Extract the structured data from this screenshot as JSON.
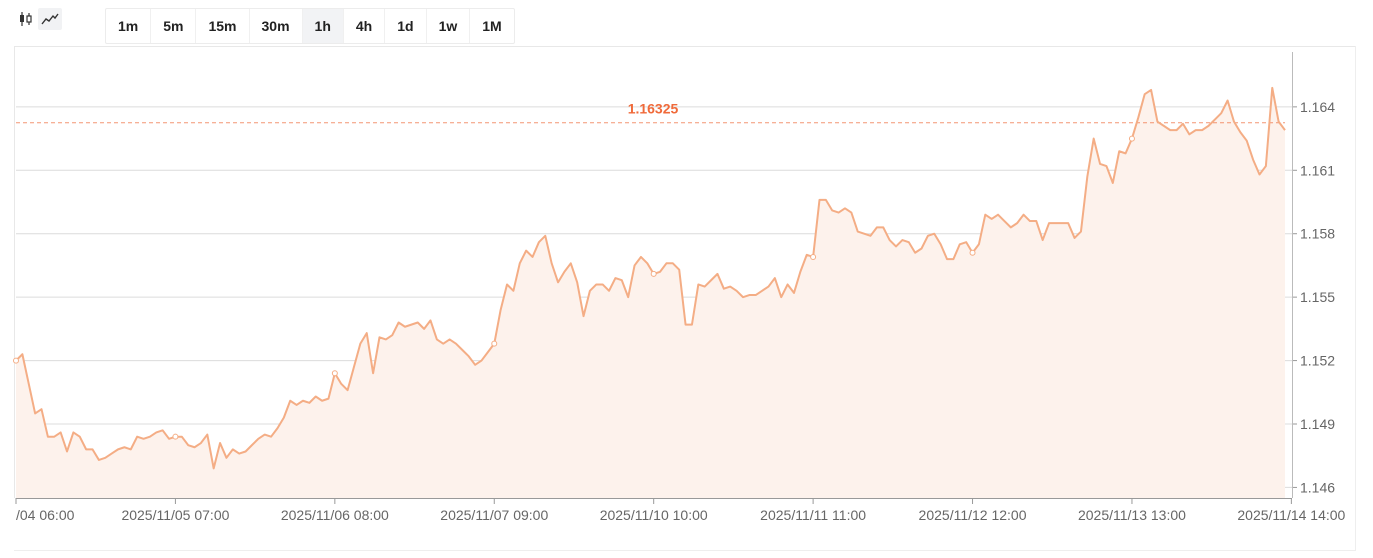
{
  "toolbar": {
    "chart_types": [
      {
        "name": "candlestick",
        "active": false
      },
      {
        "name": "line",
        "active": true
      }
    ],
    "intervals": [
      "1m",
      "5m",
      "15m",
      "30m",
      "1h",
      "4h",
      "1d",
      "1w",
      "1M"
    ],
    "active_interval": "1h"
  },
  "colors": {
    "line": "#f4ad85",
    "fill": "#fdf2ec",
    "last_price": "#f06a3a",
    "grid": "#dcdcdc",
    "axis_text": "#666666"
  },
  "chart_data": {
    "type": "line",
    "last_price_label": "1.16325",
    "last_price": 1.16325,
    "ylim": [
      1.1455,
      1.1665
    ],
    "yticks": [
      1.146,
      1.149,
      1.152,
      1.155,
      1.158,
      1.161,
      1.164
    ],
    "ytick_labels": [
      "1.146",
      "1.149",
      "1.152",
      "1.155",
      "1.158",
      "1.161",
      "1.164"
    ],
    "xtick_labels": [
      "/04 06:00",
      "2025/11/05 07:00",
      "2025/11/06 08:00",
      "2025/11/07 09:00",
      "2025/11/10 10:00",
      "2025/11/11 11:00",
      "2025/11/12 12:00",
      "2025/11/13 13:00",
      "2025/11/14 14:00"
    ],
    "xtick_index": [
      0,
      25,
      50,
      75,
      100,
      125,
      150,
      175,
      200
    ],
    "grid": true,
    "series": [
      {
        "values": [
          1.152,
          1.1523,
          1.1509,
          1.1495,
          1.1497,
          1.1484,
          1.1484,
          1.1486,
          1.1477,
          1.1486,
          1.1484,
          1.1478,
          1.1478,
          1.1473,
          1.1474,
          1.1476,
          1.1478,
          1.1479,
          1.1478,
          1.1484,
          1.1483,
          1.1484,
          1.1486,
          1.1487,
          1.1483,
          1.1484,
          1.1484,
          1.148,
          1.1479,
          1.1481,
          1.1485,
          1.1469,
          1.1481,
          1.1474,
          1.1478,
          1.1476,
          1.1477,
          1.148,
          1.1483,
          1.1485,
          1.1484,
          1.1488,
          1.1493,
          1.1501,
          1.1499,
          1.1501,
          1.15,
          1.1503,
          1.1501,
          1.1502,
          1.1514,
          1.1509,
          1.1506,
          1.1517,
          1.1528,
          1.1533,
          1.1514,
          1.1531,
          1.153,
          1.1532,
          1.1538,
          1.1536,
          1.1537,
          1.1538,
          1.1535,
          1.1539,
          1.153,
          1.1528,
          1.153,
          1.1528,
          1.1525,
          1.1522,
          1.1518,
          1.152,
          1.1524,
          1.1528,
          1.1544,
          1.1556,
          1.1553,
          1.1566,
          1.1572,
          1.1569,
          1.1576,
          1.1579,
          1.1566,
          1.1557,
          1.1562,
          1.1566,
          1.1557,
          1.1541,
          1.1553,
          1.1556,
          1.1556,
          1.1553,
          1.1559,
          1.1558,
          1.155,
          1.1565,
          1.1569,
          1.1566,
          1.1561,
          1.1562,
          1.1566,
          1.1566,
          1.1563,
          1.1537,
          1.1537,
          1.1556,
          1.1555,
          1.1558,
          1.1561,
          1.1554,
          1.1555,
          1.1553,
          1.155,
          1.1551,
          1.1551,
          1.1553,
          1.1555,
          1.1559,
          1.155,
          1.1556,
          1.1552,
          1.1562,
          1.157,
          1.1569,
          1.1596,
          1.1596,
          1.1591,
          1.159,
          1.1592,
          1.159,
          1.1581,
          1.158,
          1.1579,
          1.1583,
          1.1583,
          1.1577,
          1.1574,
          1.1577,
          1.1576,
          1.1571,
          1.1573,
          1.1579,
          1.158,
          1.1575,
          1.1568,
          1.1568,
          1.1575,
          1.1576,
          1.1571,
          1.1575,
          1.1589,
          1.1587,
          1.1589,
          1.1586,
          1.1583,
          1.1585,
          1.1589,
          1.1586,
          1.1586,
          1.1577,
          1.1585,
          1.1585,
          1.1585,
          1.1585,
          1.1578,
          1.1581,
          1.1607,
          1.1625,
          1.1613,
          1.1612,
          1.1604,
          1.1619,
          1.1618,
          1.1625,
          1.1635,
          1.1646,
          1.1648,
          1.1633,
          1.1631,
          1.1629,
          1.1629,
          1.1632,
          1.1627,
          1.1629,
          1.1629,
          1.1631,
          1.1634,
          1.1637,
          1.1643,
          1.1633,
          1.1628,
          1.1624,
          1.1615,
          1.1608,
          1.1612,
          1.1649,
          1.1633,
          1.1629
        ]
      }
    ]
  }
}
